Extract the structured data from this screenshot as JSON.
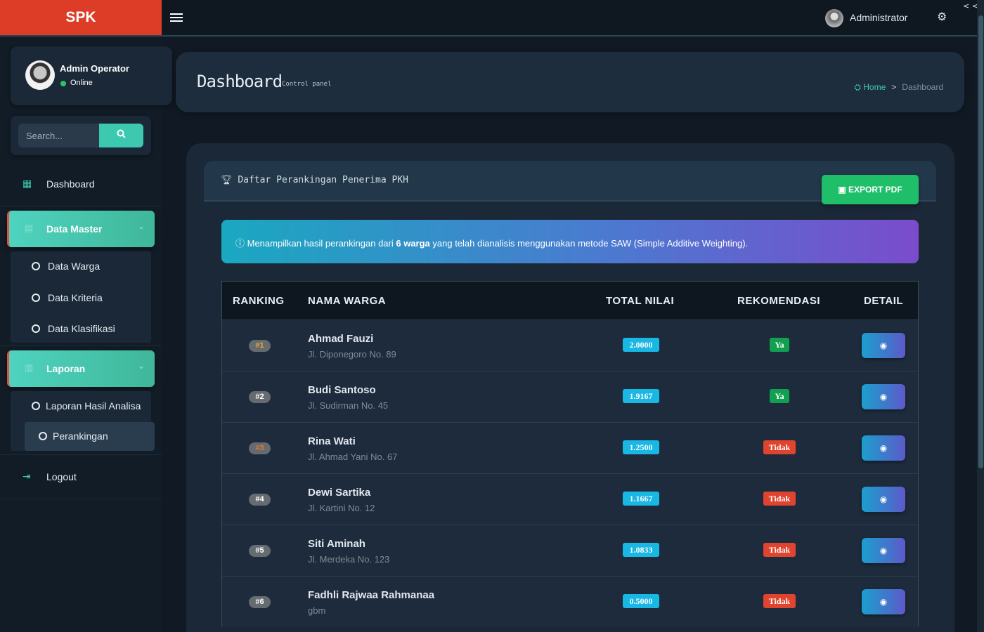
{
  "brand": "SPK",
  "topbar": {
    "admin_name": "Administrator"
  },
  "sidebar": {
    "user": {
      "name": "Admin Operator",
      "status": "Online"
    },
    "search": {
      "placeholder": "Search..."
    },
    "items": {
      "dashboard": "Dashboard",
      "data_master": "Data Master",
      "data_warga": "Data Warga",
      "data_kriteria": "Data Kriteria",
      "data_klasifikasi": "Data Klasifikasi",
      "laporan": "Laporan",
      "laporan_hasil": "Laporan Hasil Analisa",
      "perankingan": "Perankingan",
      "logout": "Logout"
    }
  },
  "header": {
    "title": "Dashboard",
    "subtitle": "Control panel",
    "breadcrumb": {
      "home": "Home",
      "separator": ">",
      "current": "Dashboard"
    }
  },
  "box": {
    "title": "Daftar Perankingan Penerima PKH",
    "export_label": "EXPORT PDF"
  },
  "alert": {
    "prefix": "Menampilkan hasil perankingan dari ",
    "count": "6 warga",
    "suffix": " yang telah dianalisis menggunakan metode SAW (Simple Additive Weighting)."
  },
  "table": {
    "columns": [
      "RANKING",
      "NAMA WARGA",
      "TOTAL NILAI",
      "REKOMENDASI",
      "DETAIL"
    ],
    "rows": [
      {
        "rank": "#1",
        "name": "Ahmad Fauzi",
        "address": "Jl. Diponegoro No. 89",
        "score": "2.0000",
        "recommendation": "Ya"
      },
      {
        "rank": "#2",
        "name": "Budi Santoso",
        "address": "Jl. Sudirman No. 45",
        "score": "1.9167",
        "recommendation": "Ya"
      },
      {
        "rank": "#3",
        "name": "Rina Wati",
        "address": "Jl. Ahmad Yani No. 67",
        "score": "1.2500",
        "recommendation": "Tidak"
      },
      {
        "rank": "#4",
        "name": "Dewi Sartika",
        "address": "Jl. Kartini No. 12",
        "score": "1.1667",
        "recommendation": "Tidak"
      },
      {
        "rank": "#5",
        "name": "Siti Aminah",
        "address": "Jl. Merdeka No. 123",
        "score": "1.0833",
        "recommendation": "Tidak"
      },
      {
        "rank": "#6",
        "name": "Fadhli Rajwaa Rahmanaa",
        "address": "gbm",
        "score": "0.5000",
        "recommendation": "Tidak"
      }
    ]
  },
  "colors": {
    "brand_bg": "#dd3d27",
    "accent": "#3dc9b0",
    "score_badge": "#18b7e4",
    "rec_yes": "#11a04f",
    "rec_no": "#e0432e",
    "export_btn": "#1fbf6a"
  },
  "icons": {
    "menu": "hamburger-icon",
    "settings": "gears-icon",
    "search": "search-icon",
    "dashboard": "grid-icon",
    "logout": "sign-out-icon",
    "trophy": "trophy-icon",
    "info": "info-circle-icon",
    "pdf": "file-pdf-icon",
    "detail": "eye-icon"
  }
}
